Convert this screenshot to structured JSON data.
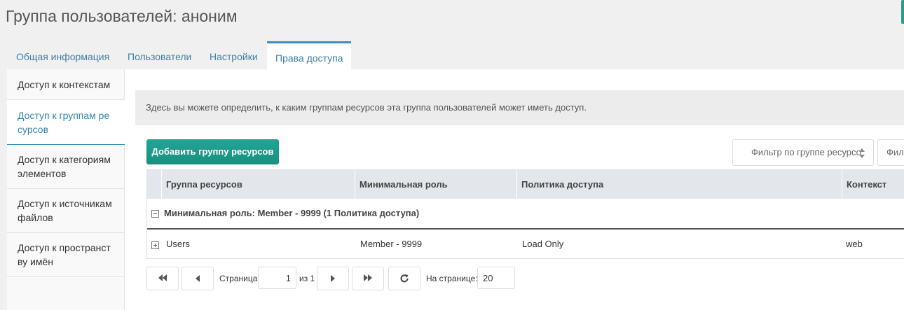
{
  "page": {
    "title": "Группа пользователей: аноним"
  },
  "colors": {
    "accent": "#3c8dbc",
    "button": "#1a9a88",
    "link": "#3883a8"
  },
  "tabs": [
    {
      "label": "Общая информация"
    },
    {
      "label": "Пользователи"
    },
    {
      "label": "Настройки"
    },
    {
      "label": "Права доступа",
      "active": true
    }
  ],
  "sidebar": {
    "items": [
      {
        "label": "Доступ к контекстам"
      },
      {
        "label": "Доступ к группам ре сурсов",
        "active": true
      },
      {
        "label": "Доступ к категориям элементов"
      },
      {
        "label": "Доступ к источникам файлов"
      },
      {
        "label": "Доступ к пространст ву имён"
      }
    ]
  },
  "main": {
    "info_text": "Здесь вы можете определить, к каким группам ресурсов эта группа пользователей может иметь доступ.",
    "add_button": "Добавить группу ресурсов",
    "filter_group_placeholder": "Фильтр по группе ресурсо",
    "filter_second_placeholder": "Филь",
    "table": {
      "columns": [
        "Группа ресурсов",
        "Минимальная роль",
        "Политика доступа",
        "Контекст"
      ],
      "group_header": "Минимальная роль: Member - 9999 (1 Политика доступа)",
      "rows": [
        {
          "resource_group": "Users",
          "min_role": "Member - 9999",
          "policy": "Load Only",
          "context": "web"
        }
      ]
    },
    "pager": {
      "page_label": "Страница",
      "page_value": "1",
      "of_label": "из 1",
      "per_page_label": "На странице:",
      "per_page_value": "20"
    }
  }
}
